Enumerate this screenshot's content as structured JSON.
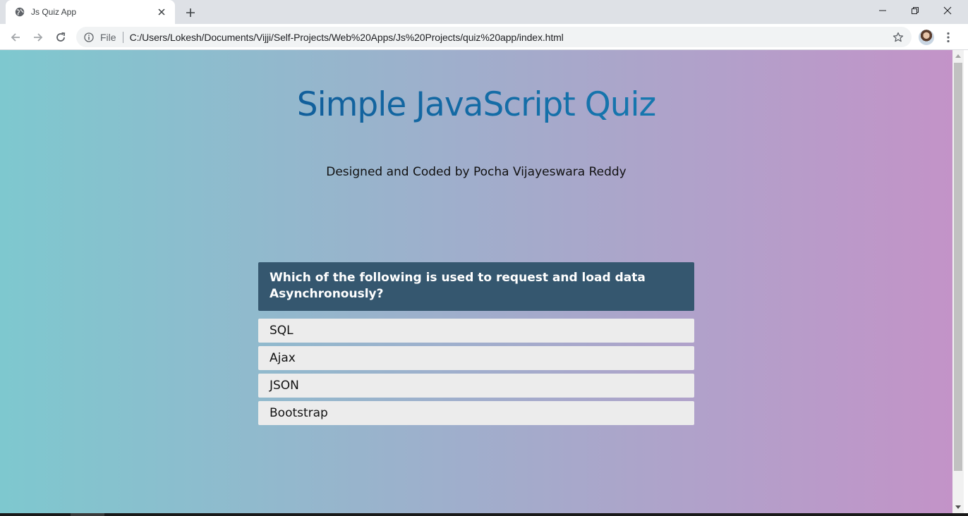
{
  "browser": {
    "tab_title": "Js Quiz App",
    "omnibox_file_label": "File",
    "url": "C:/Users/Lokesh/Documents/Vijji/Self-Projects/Web%20Apps/Js%20Projects/quiz%20app/index.html"
  },
  "page": {
    "title": "Simple JavaScript Quiz",
    "subtitle": "Designed and Coded by Pocha Vijayeswara Reddy",
    "question": "Which of the following is used to request and load data Asynchronously?",
    "choices": [
      "SQL",
      "Ajax",
      "JSON",
      "Bootstrap"
    ]
  },
  "colors": {
    "gradient_start": "#7ec8cf",
    "gradient_end": "#c393c8",
    "title_start": "#0d4a8a",
    "title_end": "#1a8cc0",
    "question_bg": "#35576f",
    "choice_bg": "#ececec"
  },
  "icons": {
    "tab_favicon": "globe-icon",
    "tab_close": "close-icon",
    "new_tab": "plus-icon",
    "back": "arrow-left-icon",
    "forward": "arrow-right-icon",
    "reload": "reload-icon",
    "site_info": "info-icon",
    "bookmark": "star-icon",
    "profile": "avatar",
    "menu": "kebab-menu-icon"
  }
}
